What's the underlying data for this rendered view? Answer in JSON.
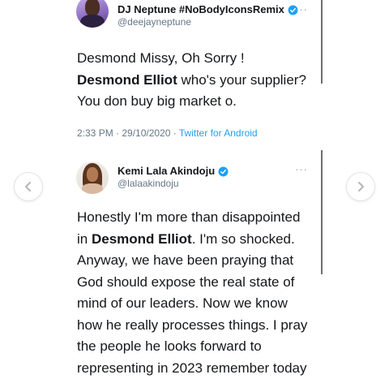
{
  "tweets": [
    {
      "display_name": "DJ Neptune #NoBodyIconsRemix",
      "handle": "@deejayneptune",
      "more_label": "···",
      "text_lines": [
        [
          {
            "t": "Desmond Missy,  Oh Sorry !",
            "b": false
          }
        ],
        [
          {
            "t": "Desmond Elliot",
            "b": true
          },
          {
            "t": " who's your supplier?",
            "b": false
          }
        ],
        [
          {
            "t": "You don buy big market o.",
            "b": false
          }
        ]
      ],
      "time": "2:33 PM",
      "date": "29/10/2020",
      "source": "Twitter for Android"
    },
    {
      "display_name": "Kemi Lala Akindoju",
      "handle": "@lalaakindoju",
      "more_label": "···",
      "text_lines": [
        [
          {
            "t": "Honestly I'm more than disappointed",
            "b": false
          }
        ],
        [
          {
            "t": "in ",
            "b": false
          },
          {
            "t": "Desmond Elliot",
            "b": true
          },
          {
            "t": ". I'm so shocked.",
            "b": false
          }
        ],
        [
          {
            "t": "Anyway, we have been praying that",
            "b": false
          }
        ],
        [
          {
            "t": "God should expose the real state of",
            "b": false
          }
        ],
        [
          {
            "t": "mind of our leaders. Now we know",
            "b": false
          }
        ],
        [
          {
            "t": "how he really processes things. I pray",
            "b": false
          }
        ],
        [
          {
            "t": "the people he looks forward to",
            "b": false
          }
        ],
        [
          {
            "t": "representing in 2023 remember today",
            "b": false
          }
        ]
      ]
    }
  ],
  "meta_separator": " · ",
  "icons": {
    "verified": "verified-badge-icon",
    "prev": "chevron-left-icon",
    "next": "chevron-right-icon"
  },
  "colors": {
    "verified": "#1da1f2",
    "link": "#1da1f2",
    "muted": "#657786"
  }
}
